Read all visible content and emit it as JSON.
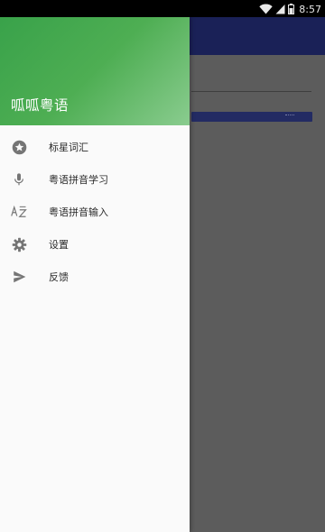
{
  "status_bar": {
    "time": "8:57",
    "icons": [
      "wifi-icon",
      "signal-icon",
      "battery-icon"
    ]
  },
  "drawer": {
    "header_title": "呱呱粤语",
    "header_colors": [
      "#39a24a",
      "#8acc8f"
    ],
    "items": [
      {
        "label": "标星词汇",
        "icon": "star-circle-icon"
      },
      {
        "label": "粤语拼音学习",
        "icon": "microphone-icon"
      },
      {
        "label": "粤语拼音输入",
        "icon": "sort-az-icon"
      },
      {
        "label": "设置",
        "icon": "gear-icon"
      },
      {
        "label": "反馈",
        "icon": "send-icon"
      }
    ]
  },
  "colors": {
    "scrim": "#5c5c5c",
    "toolbar": "#1a2157",
    "icon_gray": "#757575"
  }
}
